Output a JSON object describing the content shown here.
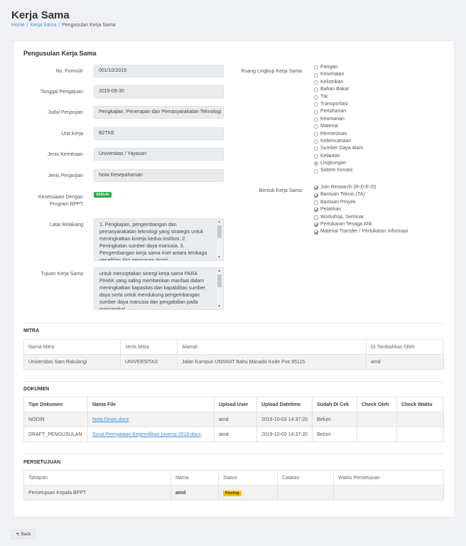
{
  "page": {
    "title": "Kerja Sama",
    "breadcrumb": {
      "home": "Home",
      "kerja_sama": "Kerja Sama",
      "current": "Pengusulan Kerja Sama"
    }
  },
  "form": {
    "title": "Pengusulan Kerja Sama",
    "no_formulir": {
      "label": "No. Formulir",
      "value": "001/10/2019"
    },
    "tanggal_pengajuan": {
      "label": "Tanggal Pengajuan",
      "value": "2019-09-30"
    },
    "judul_perjanjian": {
      "label": "Judul Perjanjian",
      "value": "Pengkajian, Penerapan dan Pemasyarakatan Teknologi"
    },
    "unit_kerja": {
      "label": "Unit Kerja",
      "value": "B2TKE"
    },
    "jenis_kemitraan": {
      "label": "Jenis Kemitraan",
      "value": "Universitas / Yayasan"
    },
    "jenis_perjanjian": {
      "label": "Jenis Perjanjian",
      "value": "Nota Kesepahaman"
    },
    "kesesuaian": {
      "label_line1": "Kesesuaian Dengan",
      "label_line2": "Program BPPT",
      "badge": "SESUAI"
    },
    "latar_belakang": {
      "label": "Latar Belakang",
      "value": "1. Pengkajian, pengembangan dan pemasyarakatan teknologi yang strategis untuk meningkatkan kinerja kedua institusi. 2. Peningkatan sumber daya manusia. 3. Pengembangan kerja sama riset antara lembaga penelitian dan perguruan tinggi."
    },
    "tujuan": {
      "label": "Tujuan Kerja Sama",
      "value": "untuk menciptakan sinergi kerja sama PARA PIHAK yang saling memberikan manfaat dalam meningkatkan kapasitas dan kapabilitas sumber daya serta untuk mendukung pengembangan sumber daya manusia dan pengabdian pada masyarakat."
    },
    "ruang_lingkup": {
      "label": "Ruang Lingkup Kerja Sama",
      "selected": "Lingkungan",
      "options": [
        "Pangan",
        "Kesehatan",
        "Kelistrikan",
        "Bahan Bakar",
        "TIK",
        "Transportasi",
        "Pertahanan",
        "Keamanan",
        "Material",
        "Permesinan",
        "Kebencanaan",
        "Sumber Daya Alam",
        "Kelautan",
        "Lingkungan",
        "Sistem Inovasi"
      ]
    },
    "bentuk": {
      "label": "Bentuk Kerja Sama",
      "options": [
        {
          "label": "Join Research (R-D-E-O)",
          "checked": true
        },
        {
          "label": "Bantuan Teknis (TA)",
          "checked": true
        },
        {
          "label": "Bantuan Proyek",
          "checked": false
        },
        {
          "label": "Pelatihan",
          "checked": true
        },
        {
          "label": "Workshop, Seminar",
          "checked": false
        },
        {
          "label": "Pertukaran Tenaga Ahli",
          "checked": true
        },
        {
          "label": "Material Transfer / Pertukaran Informasi",
          "checked": true
        }
      ]
    }
  },
  "mitra": {
    "title": "MITRA",
    "headers": [
      "Nama Mitra",
      "Jenis Mitra",
      "Alamat",
      "Di Tambahkan Oleh"
    ],
    "rows": [
      [
        "Universitas Sam Ratulangi",
        "UNIVERSITAS",
        "Jalan Kampus UNSRAT Bahu Manado Kode Pos 95115",
        "amd"
      ]
    ]
  },
  "dokumen": {
    "title": "DOKUMEN",
    "headers": [
      "Tipe Dokumen",
      "Nama File",
      "Upload User",
      "Upload Datetime",
      "Sudah Di Cek",
      "Check Oleh",
      "Check Waktu"
    ],
    "rows": [
      [
        "NODIN",
        "Nota Dinas.docx",
        "amd",
        "2019-10-03 14:37:20",
        "Belum",
        "",
        ""
      ],
      [
        "DRAFT_PENGUSULAN",
        "Surat Pernyataan Kepemilikan Invensi 2018.docx",
        "amd",
        "2019-10-03 14:37:20",
        "Belum",
        "",
        ""
      ]
    ]
  },
  "persetujuan": {
    "title": "PERSETUJUAN",
    "headers": [
      "Tahapan",
      "Nama",
      "Status",
      "Catatan",
      "Waktu Persetujuan"
    ],
    "rows": [
      {
        "tahapan": "Persetujuan Kepala BPPT",
        "nama": "amd",
        "status": "Pending",
        "catatan": "",
        "waktu": ""
      }
    ]
  },
  "back_label": "Back"
}
